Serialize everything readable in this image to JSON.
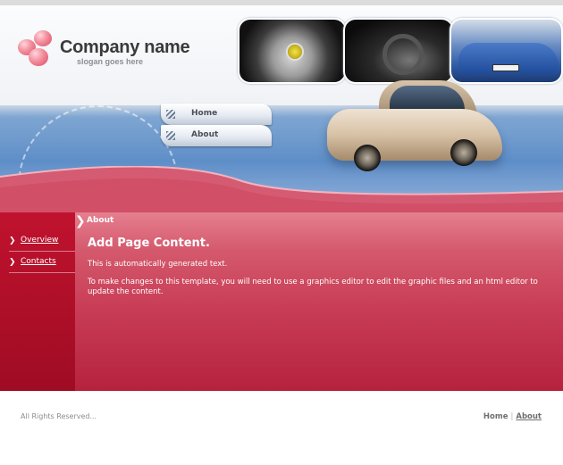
{
  "header": {
    "company_name": "Company name",
    "slogan": "slogan goes here"
  },
  "top_nav": {
    "items": [
      {
        "label": "Home"
      },
      {
        "label": "About"
      }
    ]
  },
  "sidebar": {
    "items": [
      {
        "label": "Overview"
      },
      {
        "label": "Contacts"
      }
    ]
  },
  "main": {
    "breadcrumb": "About",
    "title": "Add Page Content.",
    "paragraphs": [
      "This is automatically generated text.",
      "To make changes to this template, you will need to use a graphics editor to edit the graphic files and an html editor to update the content."
    ]
  },
  "footer": {
    "copyright": "All Rights Reserved...",
    "links": [
      {
        "label": "Home"
      },
      {
        "label": "About"
      }
    ],
    "separator": "|"
  },
  "colors": {
    "brand_red": "#c0122e",
    "header_blue": "#5e8ec8",
    "logo_pink": "#f28c9b"
  },
  "icons": {
    "logo": "logo-dots-icon",
    "nav_bullet": "stripes-icon",
    "side_bullet": "chevron-right-icon",
    "crumb_bullet": "chevron-right-icon"
  }
}
